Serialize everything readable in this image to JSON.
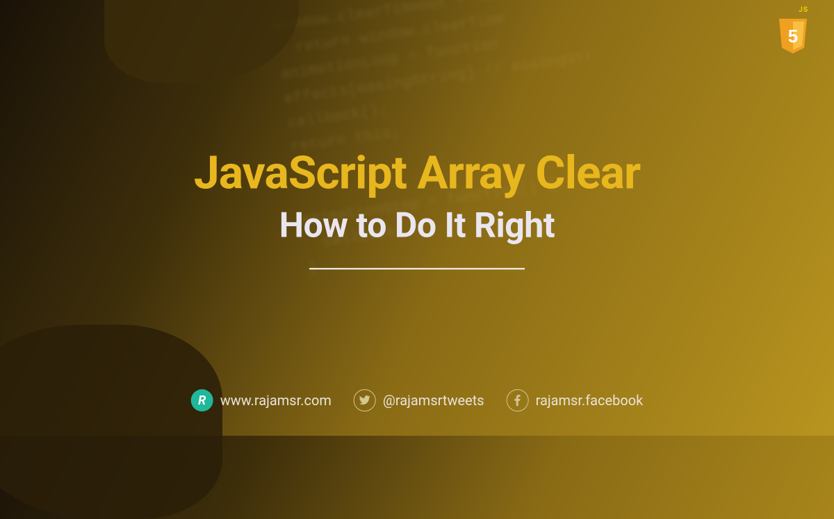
{
  "badge": {
    "label": "JS",
    "shield_number": "5"
  },
  "title": "JavaScript Array Clear",
  "subtitle": "How to Do It Right",
  "footer": {
    "website": {
      "icon_letter": "R",
      "text": "www.rajamsr.com"
    },
    "twitter": {
      "handle": "@rajamsrtweets"
    },
    "facebook": {
      "handle": "rajamsr.facebook"
    }
  },
  "code_bg": "  window.clearTimeout = function(\n    return window.clearTime\n  animationLoop = function\n  effects[easingString] // easingStr\n  callback();\n  return this;\n}\n\n  animationStep = function() {\n    callback(\n  }"
}
